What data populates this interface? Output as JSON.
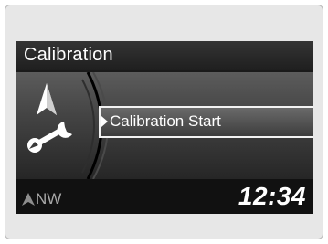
{
  "screen": {
    "title": "Calibration",
    "menu": {
      "items": [
        {
          "label": "Calibration Start",
          "selected": true
        }
      ]
    },
    "status": {
      "compass_heading": "NW",
      "clock": "12:34"
    }
  },
  "icons": {
    "left_graphic": [
      "navigation-arrow-icon",
      "wrench-icon"
    ],
    "compass": "compass-arrow-icon"
  },
  "colors": {
    "screen_bg": "#1a1a1a",
    "title_text": "#ffffff",
    "selection_border": "#f2f2f2",
    "compass_text": "#a8a8a8"
  }
}
